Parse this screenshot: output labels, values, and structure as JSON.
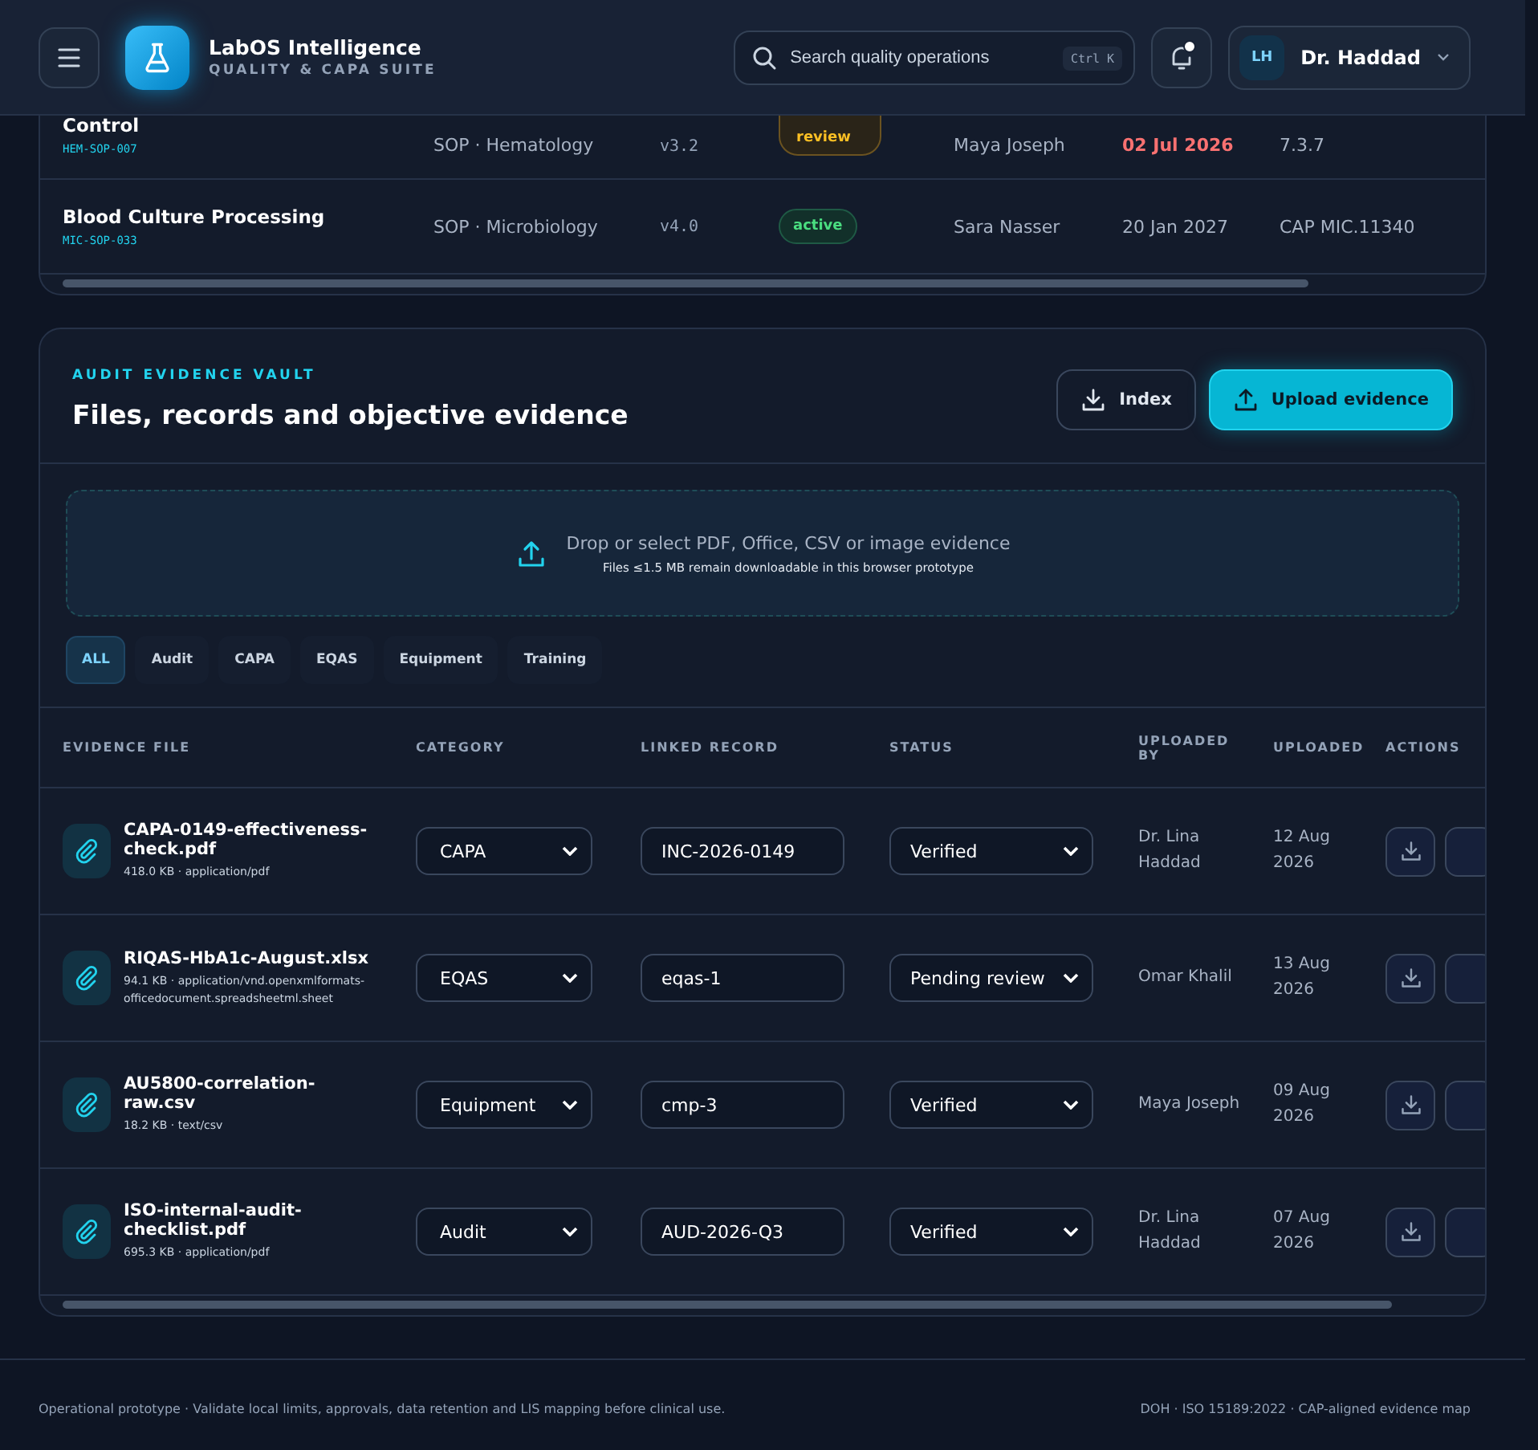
{
  "header": {
    "app_name": "LabOS Intelligence",
    "app_subtitle": "QUALITY & CAPA SUITE",
    "search": {
      "placeholder": "Search quality operations",
      "shortcut": "Ctrl K"
    },
    "notifications": {
      "unread": true
    },
    "user": {
      "initials": "LH",
      "name": "Dr. Haddad"
    }
  },
  "sop_table": {
    "rows": [
      {
        "name": "Control",
        "code": "HEM-SOP-007",
        "category": "SOP · Hematology",
        "version": "v3.2",
        "status": "review",
        "kind": "warning",
        "owner": "Maya Joseph",
        "due": "02 Jul 2026",
        "due_overdue": true,
        "reference": "7.3.7"
      },
      {
        "name": "Blood Culture Processing",
        "code": "MIC-SOP-033",
        "category": "SOP · Microbiology",
        "version": "v4.0",
        "status": "active",
        "kind": "success",
        "owner": "Sara Nasser",
        "due": "20 Jan 2027",
        "due_overdue": false,
        "reference": "CAP MIC.11340"
      }
    ]
  },
  "vault": {
    "eyebrow": "AUDIT EVIDENCE VAULT",
    "title": "Files, records and objective evidence",
    "buttons": [
      {
        "label": "Index",
        "kind": "secondary"
      },
      {
        "label": "Upload evidence",
        "kind": "primary"
      }
    ],
    "dropzone": {
      "title": "Drop or select PDF, Office, CSV or image evidence",
      "hint": "Files ≤1.5 MB remain downloadable in this browser prototype"
    },
    "filters": [
      {
        "label": "ALL",
        "selected": true
      },
      {
        "label": "Audit",
        "selected": false
      },
      {
        "label": "CAPA",
        "selected": false
      },
      {
        "label": "EQAS",
        "selected": false
      },
      {
        "label": "Equipment",
        "selected": false
      },
      {
        "label": "Training",
        "selected": false
      }
    ],
    "columns": [
      "EVIDENCE FILE",
      "CATEGORY",
      "LINKED RECORD",
      "STATUS",
      "UPLOADED BY",
      "UPLOADED",
      "ACTIONS"
    ],
    "rows": [
      {
        "file": "CAPA-0149-effectiveness-check.pdf",
        "meta": "418.0 KB · application/pdf",
        "category": "CAPA",
        "linked": "INC-2026-0149",
        "status": "Verified",
        "uploaded_by": "Dr. Lina Haddad",
        "uploaded": "12 Aug 2026"
      },
      {
        "file": "RIQAS-HbA1c-August.xlsx",
        "meta": "94.1 KB · application/vnd.openxmlformats-officedocument.spreadsheetml.sheet",
        "category": "EQAS",
        "linked": "eqas-1",
        "status": "Pending review",
        "uploaded_by": "Omar Khalil",
        "uploaded": "13 Aug 2026"
      },
      {
        "file": "AU5800-correlation-raw.csv",
        "meta": "18.2 KB · text/csv",
        "category": "Equipment",
        "linked": "cmp-3",
        "status": "Verified",
        "uploaded_by": "Maya Joseph",
        "uploaded": "09 Aug 2026"
      },
      {
        "file": "ISO-internal-audit-checklist.pdf",
        "meta": "695.3 KB · application/pdf",
        "category": "Audit",
        "linked": "AUD-2026-Q3",
        "status": "Verified",
        "uploaded_by": "Dr. Lina Haddad",
        "uploaded": "07 Aug 2026"
      }
    ]
  },
  "footer": {
    "left": "Operational prototype · Validate local limits, approvals, data retention and LIS mapping before clinical use.",
    "right": "DOH · ISO 15189:2022 · CAP-aligned evidence map"
  }
}
